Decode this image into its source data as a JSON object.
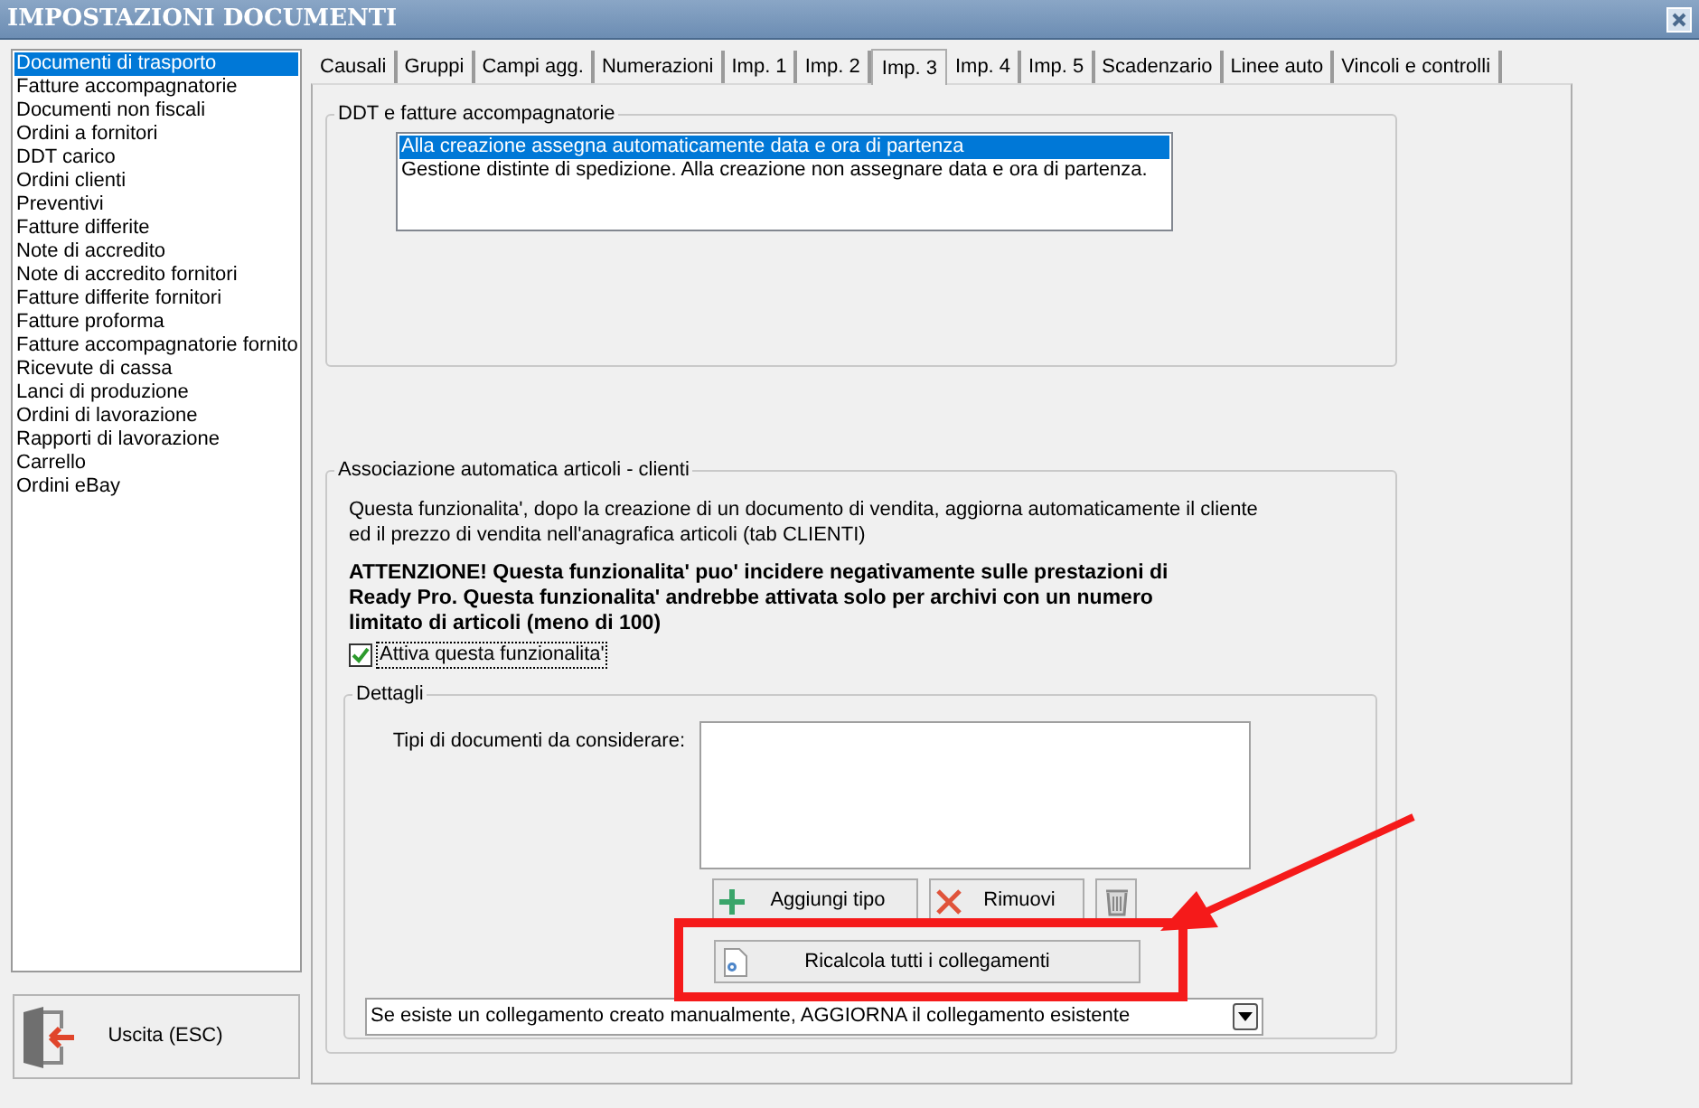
{
  "window": {
    "title": "IMPOSTAZIONI DOCUMENTI"
  },
  "sidebar": {
    "items": [
      {
        "label": "Documenti di trasporto",
        "selected": true
      },
      {
        "label": "Fatture accompagnatorie",
        "selected": false
      },
      {
        "label": "Documenti non fiscali",
        "selected": false
      },
      {
        "label": "Ordini a fornitori",
        "selected": false
      },
      {
        "label": "DDT carico",
        "selected": false
      },
      {
        "label": "Ordini clienti",
        "selected": false
      },
      {
        "label": "Preventivi",
        "selected": false
      },
      {
        "label": "Fatture differite",
        "selected": false
      },
      {
        "label": "Note di accredito",
        "selected": false
      },
      {
        "label": "Note di accredito fornitori",
        "selected": false
      },
      {
        "label": "Fatture differite fornitori",
        "selected": false
      },
      {
        "label": "Fatture proforma",
        "selected": false
      },
      {
        "label": "Fatture accompagnatorie fornito",
        "selected": false
      },
      {
        "label": "Ricevute di cassa",
        "selected": false
      },
      {
        "label": "Lanci di produzione",
        "selected": false
      },
      {
        "label": "Ordini di lavorazione",
        "selected": false
      },
      {
        "label": "Rapporti di lavorazione",
        "selected": false
      },
      {
        "label": "Carrello",
        "selected": false
      },
      {
        "label": "Ordini eBay",
        "selected": false
      }
    ],
    "exit_button": "Uscita (ESC)"
  },
  "tabs": [
    {
      "label": "Causali",
      "selected": false
    },
    {
      "label": "Gruppi",
      "selected": false
    },
    {
      "label": "Campi agg.",
      "selected": false
    },
    {
      "label": "Numerazioni",
      "selected": false
    },
    {
      "label": "Imp. 1",
      "selected": false
    },
    {
      "label": "Imp. 2",
      "selected": false
    },
    {
      "label": "Imp. 3",
      "selected": true
    },
    {
      "label": "Imp. 4",
      "selected": false
    },
    {
      "label": "Imp. 5",
      "selected": false
    },
    {
      "label": "Scadenzario",
      "selected": false
    },
    {
      "label": "Linee auto",
      "selected": false
    },
    {
      "label": "Vincoli e controlli",
      "selected": false
    }
  ],
  "ddt_group": {
    "title": "DDT e fatture accompagnatorie",
    "options": [
      {
        "label": "Alla creazione assegna automaticamente data e ora di partenza",
        "selected": true
      },
      {
        "label": "Gestione distinte di spedizione. Alla creazione non assegnare data e ora di partenza.",
        "selected": false
      }
    ]
  },
  "association_group": {
    "title": "Associazione automatica articoli - clienti",
    "description": "Questa funzionalita', dopo la creazione di un documento di vendita, aggiorna automaticamente il cliente ed il prezzo di vendita nell'anagrafica articoli (tab CLIENTI)",
    "warning": "ATTENZIONE! Questa funzionalita' puo' incidere negativamente sulle prestazioni di Ready Pro. Questa funzionalita' andrebbe attivata solo per archivi con un numero limitato di articoli (meno di 100)",
    "checkbox": {
      "label": "Attiva questa funzionalita'",
      "checked": true
    },
    "details": {
      "title": "Dettagli",
      "list_label": "Tipi di documenti da considerare:",
      "buttons": [
        {
          "kind": "add",
          "label": "Aggiungi tipo"
        },
        {
          "kind": "remove",
          "label": "Rimuovi"
        },
        {
          "kind": "trash"
        }
      ],
      "recalc_button": "Ricalcola tutti i collegamenti",
      "dropdown": {
        "value": "Se esiste un collegamento creato manualmente, AGGIORNA il collegamento esistente"
      }
    }
  }
}
